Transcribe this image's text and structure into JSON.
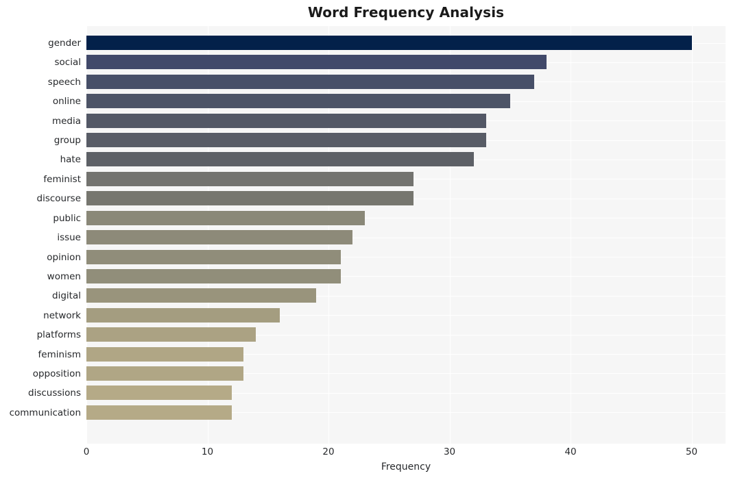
{
  "chart_data": {
    "type": "bar",
    "orientation": "horizontal",
    "title": "Word Frequency Analysis",
    "xlabel": "Frequency",
    "ylabel": "",
    "xlim": [
      0,
      52.8
    ],
    "xticks": [
      0,
      10,
      20,
      30,
      40,
      50
    ],
    "xtick_labels": [
      "0",
      "10",
      "20",
      "30",
      "40",
      "50"
    ],
    "grid": true,
    "grid_color": "#ffffff",
    "plot_background": "#f6f6f6",
    "figure_background": "#ffffff",
    "legend": null,
    "categories": [
      "gender",
      "social",
      "speech",
      "online",
      "media",
      "group",
      "hate",
      "feminist",
      "discourse",
      "public",
      "issue",
      "opinion",
      "women",
      "digital",
      "network",
      "platforms",
      "feminism",
      "opposition",
      "discussions",
      "communication"
    ],
    "values": [
      50,
      38,
      37,
      35,
      33,
      33,
      32,
      27,
      27,
      23,
      22,
      21,
      21,
      19,
      16,
      14,
      13,
      13,
      12,
      12
    ],
    "bar_colors": [
      "#03214a",
      "#41496a",
      "#474f68",
      "#4d5467",
      "#535866",
      "#585c66",
      "#5d6066",
      "#73736f",
      "#76766f",
      "#8a8878",
      "#8d8a79",
      "#908d7a",
      "#918e7a",
      "#99947c",
      "#a49d80",
      "#ab a283",
      "#b0a685",
      "#b0a685",
      "#b5aa87",
      "#b5aa87"
    ]
  }
}
